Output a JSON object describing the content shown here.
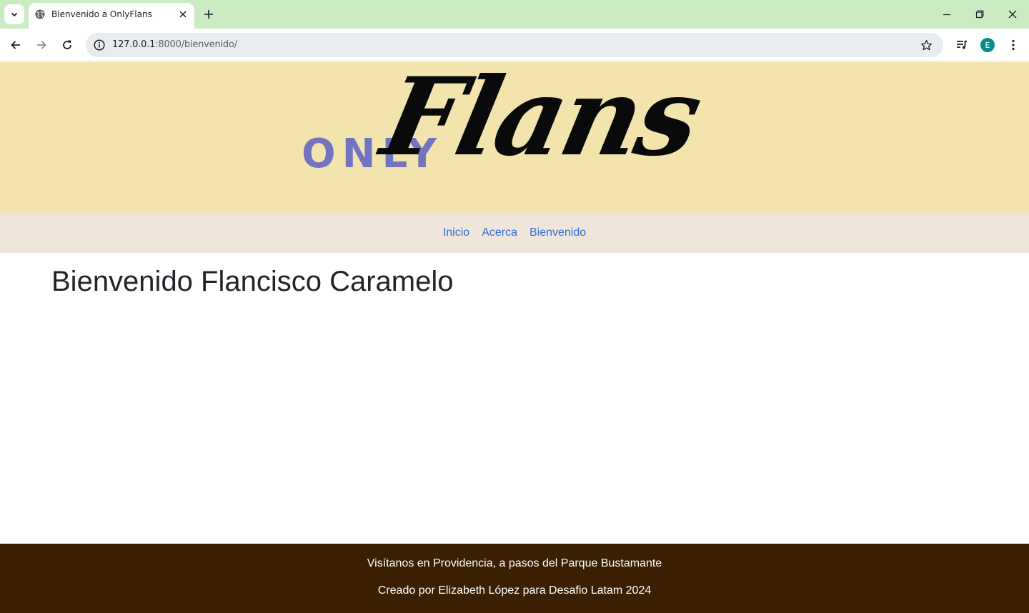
{
  "browser": {
    "tab_title": "Bienvenido a OnlyFlans",
    "url_host": "127.0.0.1",
    "url_path": ":8000/bienvenido/",
    "profile_initial": "E",
    "icons": {
      "tab_search": "chevron-down-icon",
      "favicon": "globe-icon",
      "tab_close": "close-icon",
      "new_tab": "plus-icon",
      "minimize": "minimize-icon",
      "restore": "restore-icon",
      "close_window": "close-icon",
      "back": "arrow-left-icon",
      "forward": "arrow-right-icon",
      "reload": "reload-icon",
      "site_info": "info-icon",
      "bookmark": "star-icon",
      "media": "media-control-icon",
      "menu": "kebab-menu-icon"
    },
    "colors": {
      "tabstrip": "#cbebc2",
      "avatar": "#0b8c8c"
    }
  },
  "site": {
    "logo": {
      "word_only": "ONLY",
      "word_flans": "Flans"
    },
    "nav": [
      {
        "label": "Inicio"
      },
      {
        "label": "Acerca"
      },
      {
        "label": "Bienvenido"
      }
    ],
    "heading": "Bienvenido Flancisco Caramelo",
    "footer": {
      "line1": "Visítanos en Providencia, a pasos del Parque Bustamante",
      "line2": "Creado por Elizabeth López para Desafio Latam 2024"
    },
    "colors": {
      "banner": "#f3e4ae",
      "navbar": "#efe5da",
      "link": "#2e6fd8",
      "footer": "#3b1f02",
      "logo_only": "#7274c2"
    }
  }
}
